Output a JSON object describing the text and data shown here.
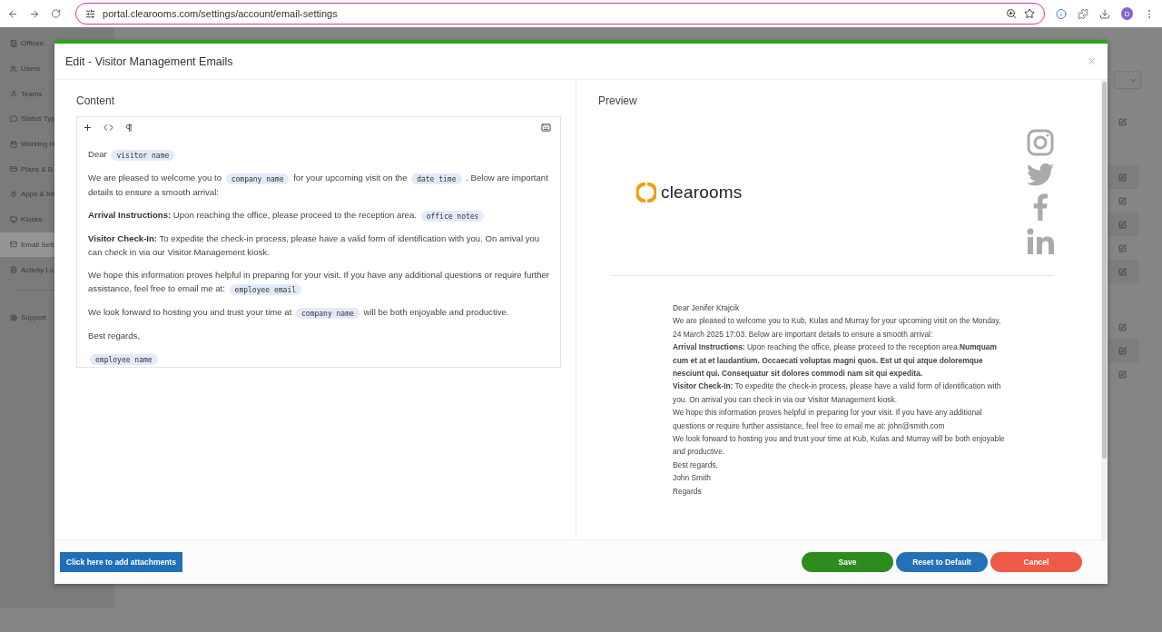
{
  "browser": {
    "url": "portal.clearooms.com/settings/account/email-settings",
    "profile_initial": "D"
  },
  "sidebar": {
    "items": [
      {
        "label": "Offices",
        "selected": false
      },
      {
        "label": "Users",
        "selected": false
      },
      {
        "label": "Teams",
        "selected": false
      },
      {
        "label": "Status Typ",
        "selected": false
      },
      {
        "label": "Working H",
        "selected": false
      },
      {
        "label": "Plans & B",
        "selected": false
      },
      {
        "label": "Apps & Int",
        "selected": false
      },
      {
        "label": "Kiosks",
        "selected": false
      },
      {
        "label": "Email Sett",
        "selected": true
      },
      {
        "label": "Activity Lo",
        "selected": false
      }
    ],
    "footer_items": [
      {
        "label": "Support"
      }
    ]
  },
  "modal": {
    "title": "Edit - Visitor Management Emails",
    "content": {
      "heading": "Content",
      "paragraphs": [
        [
          {
            "kind": "text",
            "text": "Dear"
          },
          {
            "kind": "tag",
            "text": "visitor name"
          }
        ],
        [
          {
            "kind": "text",
            "text": "We are pleased to welcome you to"
          },
          {
            "kind": "tag",
            "text": "company name"
          },
          {
            "kind": "text",
            "text": "for your upcoming visit on the"
          },
          {
            "kind": "tag",
            "text": "date time"
          },
          {
            "kind": "text",
            "text": ". Below are important details to ensure a smooth arrival:"
          }
        ],
        [
          {
            "kind": "bold",
            "text": "Arrival Instructions:"
          },
          {
            "kind": "text",
            "text": "Upon reaching the office, please proceed to the reception area."
          },
          {
            "kind": "tag",
            "text": "office notes"
          }
        ],
        [
          {
            "kind": "bold",
            "text": "Visitor Check-In:"
          },
          {
            "kind": "text",
            "text": "To expedite the check-in process, please have a valid form of identification with you. On arrival you can check in via our Visitor Management kiosk."
          }
        ],
        [
          {
            "kind": "text",
            "text": "We hope this information proves helpful in preparing for your visit. If you have any additional questions or require further assistance, feel free to email me at:"
          },
          {
            "kind": "tag",
            "text": "employee email"
          }
        ],
        [
          {
            "kind": "text",
            "text": "We look forward to hosting you and trust your time at"
          },
          {
            "kind": "tag",
            "text": "company name"
          },
          {
            "kind": "text",
            "text": "will be both enjoyable and productive."
          }
        ],
        [
          {
            "kind": "text",
            "text": "Best regards,"
          }
        ],
        [
          {
            "kind": "tag",
            "text": "employee name"
          }
        ]
      ]
    },
    "preview": {
      "heading": "Preview",
      "logo": "clearooms",
      "lines": [
        "Dear Jenifer Krajcik",
        "We are pleased to welcome you to Kub, Kulas and Murray for your upcoming visit on the Monday, 24 March 2025 17:03. Below are important details to ensure a smooth arrival:",
        "**Arrival Instructions:** Upon reaching the office, please proceed to the reception area.**Numquam cum et at et laudantium. Occaecati voluptas magni quos. Est ut qui atque doloremque nesciunt qui. Consequatur sit dolores commodi nam sit qui expedita.**",
        "**Visitor Check-In:** To expedite the check-in process, please have a valid form of identification with you. On arrival you can check in via our Visitor Management kiosk.",
        "We hope this information proves helpful in preparing for your visit. If you have any additional questions or require further assistance, feel free to email me at: john@smith.com",
        "We look forward to hosting you and trust your time at Kub, Kulas and Murray will be both enjoyable and productive.",
        "Best regards,",
        "John Smith",
        "Regards"
      ]
    },
    "buttons": [
      {
        "kind": "attach",
        "label": "Click here to add attachments"
      },
      {
        "kind": "save",
        "label": "Save"
      },
      {
        "kind": "reset",
        "label": "Reset to Default"
      },
      {
        "kind": "cancel",
        "label": "Cancel"
      }
    ]
  }
}
